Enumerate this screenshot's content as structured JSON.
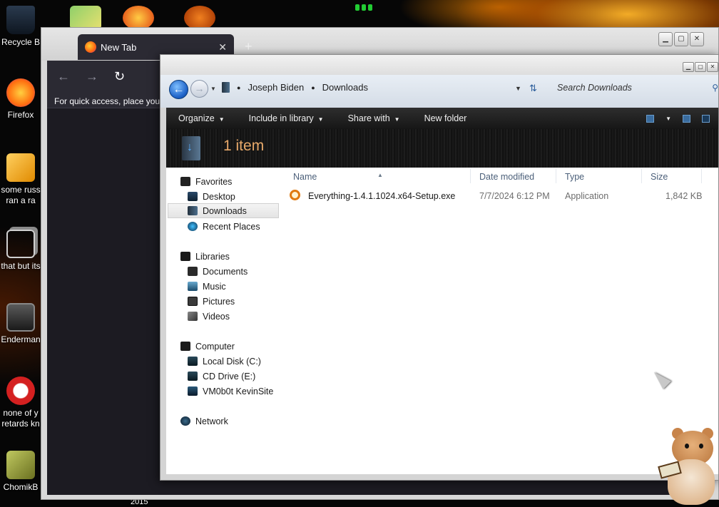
{
  "desktop": {
    "icons": [
      {
        "label_lines": [
          "Recycle B"
        ],
        "icon": "recycle-bin-icon",
        "color": "#1d2a3a"
      },
      {
        "label_lines": [
          "Firefox"
        ],
        "icon": "firefox-star-icon",
        "color": "#ff8a10"
      },
      {
        "label_lines": [
          "some russ",
          "ran a ra"
        ],
        "icon": "orange-document-icon",
        "color": "#f0a020"
      },
      {
        "label_lines": [
          "that but its"
        ],
        "icon": "stacked-window-icon",
        "color": "#dcdcdc"
      },
      {
        "label_lines": [
          "Enderman"
        ],
        "icon": "monitor-icon",
        "color": "#7a7a7a"
      },
      {
        "label_lines": [
          "none of y",
          "retards kn"
        ],
        "icon": "red-circle-icon",
        "color": "#d42020"
      },
      {
        "label_lines": [
          "ChomikB"
        ],
        "icon": "hamster-photo-icon",
        "color": "#a8b040"
      }
    ],
    "bottom_label": "2015"
  },
  "browser": {
    "tab_title": "New Tab",
    "tab_close": "✕",
    "new_tab": "+",
    "nav": {
      "back": "←",
      "forward": "→",
      "reload": "↻"
    },
    "bookmarks_hint": "For quick access, place your",
    "window_controls": {
      "minimize": "▁",
      "maximize": "▢",
      "close": "✕"
    }
  },
  "explorer": {
    "window_controls": {
      "minimize": "▁",
      "maximize": "▢",
      "close": "✕"
    },
    "breadcrumb": [
      "Joseph Biden",
      "Downloads"
    ],
    "search_placeholder": "Search Downloads",
    "commands": [
      {
        "label": "Organize",
        "dropdown": true
      },
      {
        "label": "Include in library",
        "dropdown": true
      },
      {
        "label": "Share with",
        "dropdown": true
      },
      {
        "label": "New folder",
        "dropdown": false
      }
    ],
    "item_count": "1 item",
    "nav_pane": {
      "favorites": {
        "label": "Favorites",
        "items": [
          "Desktop",
          "Downloads",
          "Recent Places"
        ]
      },
      "libraries": {
        "label": "Libraries",
        "items": [
          "Documents",
          "Music",
          "Pictures",
          "Videos"
        ]
      },
      "computer": {
        "label": "Computer",
        "items": [
          "Local Disk (C:)",
          "CD Drive (E:)",
          "VM0b0t KevinSite"
        ]
      },
      "network": {
        "label": "Network"
      }
    },
    "selected_nav": "Downloads",
    "columns": [
      "Name",
      "Date modified",
      "Type",
      "Size"
    ],
    "files": [
      {
        "name": "Everything-1.4.1.1024.x64-Setup.exe",
        "date_modified": "7/7/2024 6:12 PM",
        "type": "Application",
        "size": "1,842 KB",
        "icon": "everything-search-icon"
      }
    ]
  }
}
